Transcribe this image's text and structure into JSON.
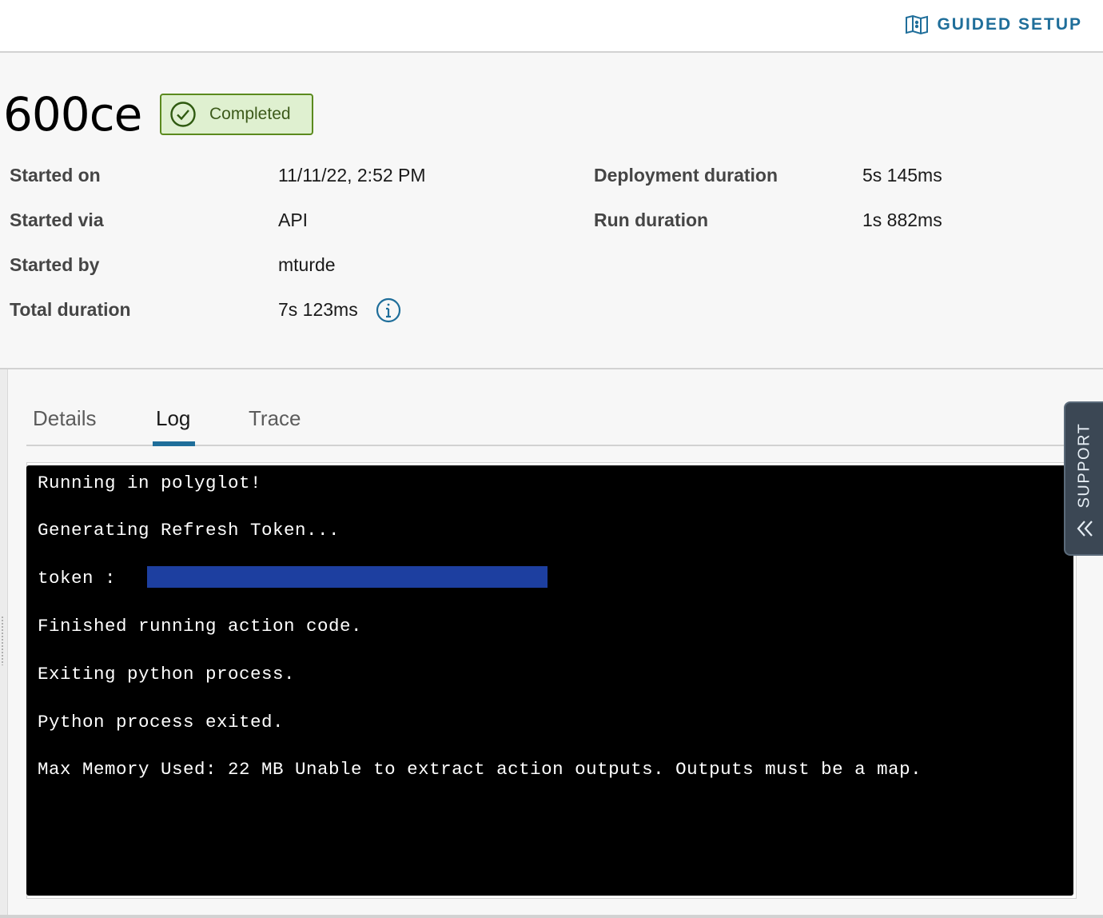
{
  "topbar": {
    "guided_setup_label": "GUIDED SETUP"
  },
  "run": {
    "id": "600ce",
    "status": "Completed"
  },
  "meta_left": [
    {
      "label": "Started on",
      "value": "11/11/22, 2:52 PM"
    },
    {
      "label": "Started via",
      "value": "API"
    },
    {
      "label": "Started by",
      "value": "mturde"
    },
    {
      "label": "Total duration",
      "value": "7s 123ms"
    }
  ],
  "meta_right": [
    {
      "label": "Deployment duration",
      "value": "5s 145ms"
    },
    {
      "label": "Run duration",
      "value": "1s 882ms"
    }
  ],
  "tabs": [
    {
      "label": "Details"
    },
    {
      "label": "Log"
    },
    {
      "label": "Trace"
    }
  ],
  "active_tab": "Log",
  "log_lines": [
    "Running in polyglot!",
    "Generating Refresh Token...",
    "token :",
    "Finished running action code.",
    "Exiting python process.",
    "Python process exited.",
    "Max Memory Used: 22 MB Unable to extract action outputs. Outputs must be a map."
  ],
  "support_label": "SUPPORT",
  "colors": {
    "accent": "#1f6e9a",
    "success_border": "#5b8a1e",
    "success_bg": "#dff0d0",
    "redaction": "#1d3fa0"
  },
  "icons": {
    "guided_setup": "map-icon",
    "status": "check-circle-icon",
    "info": "info-icon",
    "support": "double-chevron-left-icon"
  }
}
